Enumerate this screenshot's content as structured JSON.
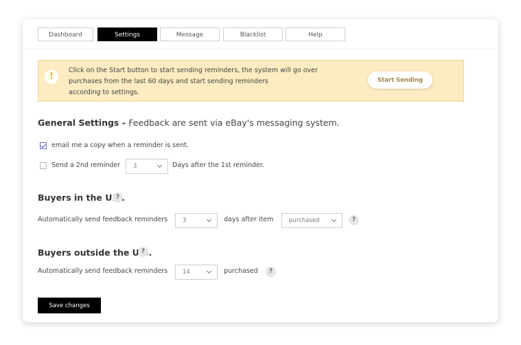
{
  "tabs": [
    {
      "label": "Dashboard",
      "active": false
    },
    {
      "label": "Settings",
      "active": true
    },
    {
      "label": "Message",
      "active": false
    },
    {
      "label": "Blacklist",
      "active": false
    },
    {
      "label": "Help",
      "active": false
    }
  ],
  "alert": {
    "icon": "!",
    "lines": [
      "Click on the Start button to start sending reminders, the system will go over",
      "purchases from the last 60 days and start sending reminders",
      "according to settings."
    ],
    "button_label": "Start Sending"
  },
  "general": {
    "title": "General Settings - ",
    "subtitle": "Feedback are sent via eBay's messaging system.",
    "email_copy": {
      "checked": true,
      "label": "email me a copy when a reminder is sent."
    },
    "second_reminder": {
      "checked": false,
      "label": "Send a 2nd reminder",
      "value": "3",
      "suffix": "Days after the 1st reminder."
    }
  },
  "us": {
    "title": "Buyers in the U.S.",
    "help": "?",
    "label": "Automatically send feedback reminders",
    "days_value": "3",
    "middle_text": "days after item",
    "event_value": "purchased"
  },
  "outside": {
    "title": "Buyers outside the U.S.",
    "help": "?",
    "label": "Automatically send feedback reminders",
    "days_value": "14",
    "suffix": "purchased"
  },
  "save_label": "Save changes",
  "colors": {
    "accent": "#000000",
    "alert_bg": "#fdebc1",
    "start_text": "#a88350",
    "check": "#5050b8"
  }
}
